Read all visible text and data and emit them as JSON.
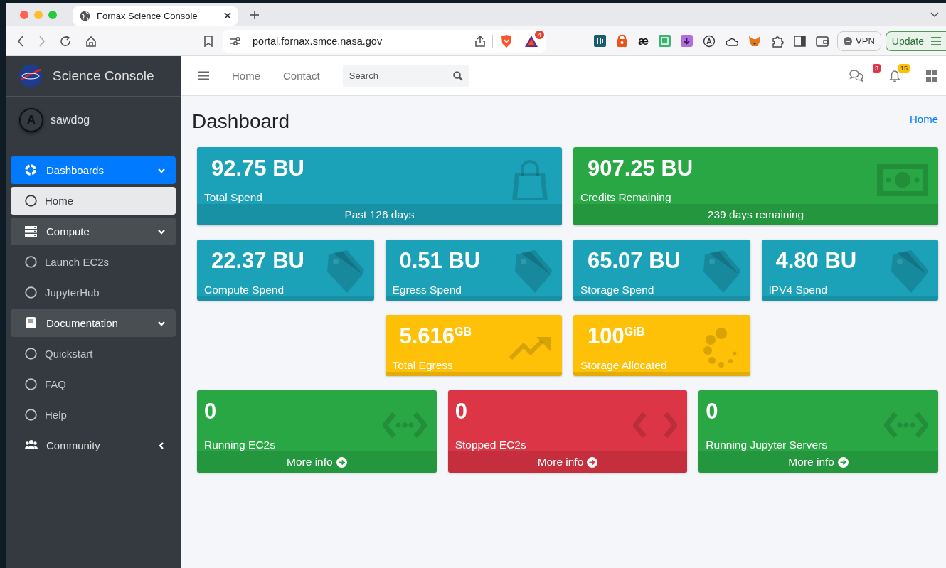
{
  "browser": {
    "tab": {
      "title": "Fornax Science Console"
    },
    "address": "portal.fornax.smce.nasa.gov",
    "extension_badge": "4",
    "extension_glyph": "æ",
    "vpn_button": "VPN",
    "update_button": "Update"
  },
  "sidebar": {
    "brand": "Science Console",
    "user": {
      "avatar_letter": "A",
      "name": "sawdog"
    },
    "nav": [
      {
        "label": "Dashboards",
        "selected": true,
        "expanded": true,
        "children": [
          {
            "label": "Home",
            "selected": true
          }
        ]
      },
      {
        "label": "Compute",
        "selected": false,
        "expanded": true,
        "children": [
          {
            "label": "Launch EC2s",
            "selected": false
          },
          {
            "label": "JupyterHub",
            "selected": false
          }
        ]
      },
      {
        "label": "Documentation",
        "selected": false,
        "expanded": true,
        "children": [
          {
            "label": "Quickstart",
            "selected": false
          },
          {
            "label": "FAQ",
            "selected": false
          },
          {
            "label": "Help",
            "selected": false
          }
        ]
      },
      {
        "label": "Community",
        "selected": false,
        "expanded": false
      }
    ]
  },
  "topbar": {
    "links": [
      "Home",
      "Contact"
    ],
    "search": {
      "placeholder": "Search"
    },
    "messages_badge": "3",
    "notifications_badge": "15"
  },
  "page": {
    "title": "Dashboard",
    "breadcrumb": "Home"
  },
  "card_rows": [
    {
      "kind": "wide",
      "cards": [
        {
          "value": "92.75 BU",
          "label": "Total Spend",
          "color": "#1ba2b8",
          "kind": "bag",
          "footer": {
            "kind": "note",
            "text": "Past 126 days"
          }
        },
        {
          "value": "907.25 BU",
          "label": "Credits Remaining",
          "color": "#29a744",
          "kind": "money",
          "footer": {
            "kind": "note",
            "text": "239 days remaining"
          }
        }
      ]
    },
    {
      "kind": "quarter",
      "cards": [
        {
          "value": "22.37 BU",
          "label": "Compute Spend",
          "color": "#1ba2b8",
          "kind": "tag"
        },
        {
          "value": "0.51 BU",
          "label": "Egress Spend",
          "color": "#1ba2b8",
          "kind": "tag"
        },
        {
          "value": "65.07 BU",
          "label": "Storage Spend",
          "color": "#1ba2b8",
          "kind": "tag"
        },
        {
          "value": "4.80 BU",
          "label": "IPV4 Spend",
          "color": "#1ba2b8",
          "kind": "tag"
        }
      ]
    },
    {
      "kind": "quarter",
      "cards": [
        {
          "value": "5.616$^{GB}$",
          "label": "Total Egress",
          "color": "#fec107",
          "kind": "trend"
        },
        {
          "value": "100$^{GiB}$",
          "label": "Storage Allocated",
          "color": "#fec107",
          "kind": "dots"
        }
      ]
    },
    {
      "kind": "third",
      "cards": [
        {
          "value": "0",
          "label": "Running EC2s",
          "color": "#29a744",
          "kind": "code",
          "footer": {
            "kind": "link",
            "text": "More info"
          }
        },
        {
          "value": "0",
          "label": "Stopped EC2s",
          "color": "#dc3545",
          "kind": "chevrons",
          "footer": {
            "kind": "link",
            "text": "More info"
          }
        },
        {
          "value": "0",
          "label": "Running Jupyter Servers",
          "color": "#29a744",
          "kind": "code",
          "footer": {
            "kind": "link",
            "text": "More info"
          }
        }
      ]
    }
  ]
}
